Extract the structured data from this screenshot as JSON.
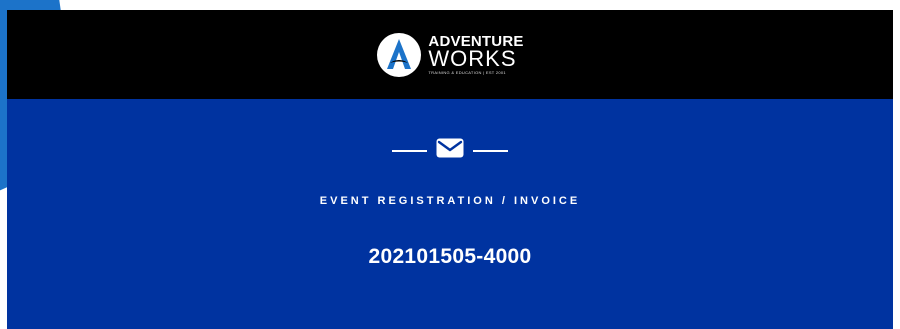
{
  "brand": {
    "name_line1": "ADVENTURE",
    "name_line2": "WORKS",
    "tagline": "TRAINING & EDUCATION | EST 2001"
  },
  "header": {
    "background": "#000000",
    "logo_icon": "mountain-a-logo-icon"
  },
  "body": {
    "background": "#0033a0",
    "divider_icon": "envelope-icon",
    "kicker": "EVENT REGISTRATION / INVOICE",
    "invoice_number": "202101505-4000"
  },
  "colors": {
    "accent": "#1c73c9",
    "text": "#ffffff"
  }
}
